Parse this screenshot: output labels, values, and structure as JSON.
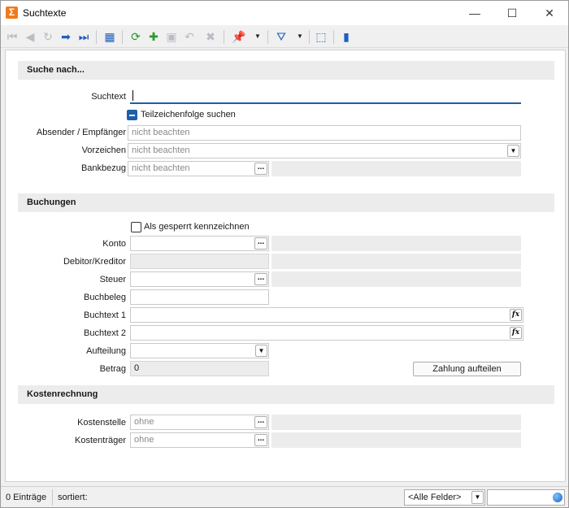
{
  "window": {
    "title": "Suchtexte",
    "app_icon_glyph": "Σ",
    "controls": {
      "minimize": "—",
      "maximize": "☐",
      "close": "✕"
    }
  },
  "toolbar": {
    "icons": [
      "first-record-icon",
      "previous-record-icon",
      "refresh-disabled-icon",
      "next-record-icon",
      "last-record-icon",
      "table-view-icon",
      "reload-icon",
      "new-record-icon",
      "save-icon",
      "undo-icon",
      "delete-icon",
      "pin-icon",
      "filter-icon",
      "select-cursor-icon",
      "book-icon"
    ],
    "colors": {
      "enabled": "#1f5fbf",
      "disabled": "#b8bcc4",
      "green": "#2a9a2a"
    }
  },
  "sections": {
    "suche": "Suche nach...",
    "buchungen": "Buchungen",
    "kosten": "Kostenrechnung"
  },
  "suche": {
    "suchtext_label": "Suchtext",
    "suchtext_value": "",
    "teilzeichen_label": "Teilzeichenfolge suchen",
    "absender_label": "Absender / Empfänger",
    "absender_value": "nicht beachten",
    "vorzeichen_label": "Vorzeichen",
    "vorzeichen_value": "nicht beachten",
    "bankbezug_label": "Bankbezug",
    "bankbezug_value": "nicht beachten"
  },
  "buchungen": {
    "gesperrt_label": "Als gesperrt kennzeichnen",
    "konto_label": "Konto",
    "konto_value": "",
    "debitor_label": "Debitor/Kreditor",
    "steuer_label": "Steuer",
    "buchbeleg_label": "Buchbeleg",
    "buchtext1_label": "Buchtext 1",
    "buchtext2_label": "Buchtext 2",
    "aufteilung_label": "Aufteilung",
    "betrag_label": "Betrag",
    "betrag_value": "0",
    "zahlung_button": "Zahlung aufteilen",
    "fx_glyph": "fx",
    "dots_glyph": "..."
  },
  "kosten": {
    "kostenstelle_label": "Kostenstelle",
    "kostenstelle_value": "ohne",
    "kostentraeger_label": "Kostenträger",
    "kostentraeger_value": "ohne"
  },
  "statusbar": {
    "count": "0 Einträge",
    "sort": "sortiert:",
    "field_select": "<Alle Felder>",
    "search_value": ""
  },
  "colors": {
    "accent": "#1d5fa8",
    "section_bg": "#ececec",
    "app_icon": "#f07a1a"
  }
}
